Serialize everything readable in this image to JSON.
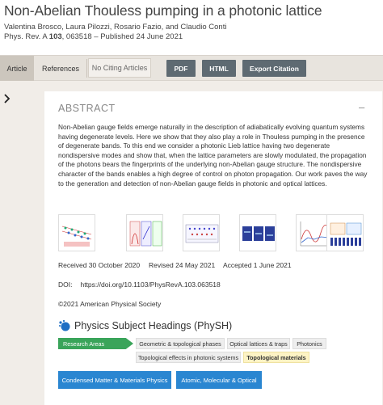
{
  "article": {
    "title": "Non-Abelian Thouless pumping in a photonic lattice",
    "authors": "Valentina Brosco, Laura Pilozzi, Rosario Fazio, and Claudio Conti",
    "journal": "Phys. Rev. A",
    "volume": "103",
    "citation_rest": ", 063518 – Published 24 June 2021"
  },
  "tabs": {
    "article": "Article",
    "references": "References",
    "no_citing": "No Citing Articles"
  },
  "buttons": {
    "pdf": "PDF",
    "html": "HTML",
    "export": "Export Citation"
  },
  "abstract": {
    "heading": "ABSTRACT",
    "collapse": "–",
    "text": "Non-Abelian gauge fields emerge naturally in the description of adiabatically evolving quantum systems having degenerate levels. Here we show that they also play a role in Thouless pumping in the presence of degenerate bands. To this end we consider a photonic Lieb lattice having two degenerate nondispersive modes and show that, when the lattice parameters are slowly modulated, the propagation of the photons bears the fingerprints of the underlying non-Abelian gauge structure. The nondispersive character of the bands enables a high degree of control on photon propagation. Our work paves the way to the generation and detection of non-Abelian gauge fields in photonic and optical lattices."
  },
  "figures": [
    "figure-1",
    "figure-2",
    "figure-3",
    "figure-4",
    "figure-5",
    "figure-6"
  ],
  "dates": {
    "received": "Received 30 October 2020",
    "revised": "Revised 24 May 2021",
    "accepted": "Accepted 1 June 2021"
  },
  "doi": {
    "label": "DOI:",
    "value": "https://doi.org/10.1103/PhysRevA.103.063518"
  },
  "copyright": "©2021 American Physical Society",
  "physh": {
    "heading": "Physics Subject Headings (PhySH)",
    "research_areas": "Research Areas",
    "tags": [
      "Geometric & topological phases",
      "Optical lattices & traps",
      "Photonics",
      "Topological effects in photonic systems",
      "Topological materials"
    ],
    "highlighted_tag": "Topological materials",
    "categories": [
      "Condensed Matter & Materials Physics",
      "Atomic, Molecular & Optical"
    ]
  },
  "colors": {
    "tab_bar": "#e8e4de",
    "dark_button": "#5e6a72",
    "blue_button": "#2a86d1",
    "research_green": "#3aa45a",
    "highlight": "#fdf3c4",
    "page_bg": "#f1ede8"
  },
  "icons": [
    "chevron-right-icon",
    "physh-logo-icon"
  ]
}
